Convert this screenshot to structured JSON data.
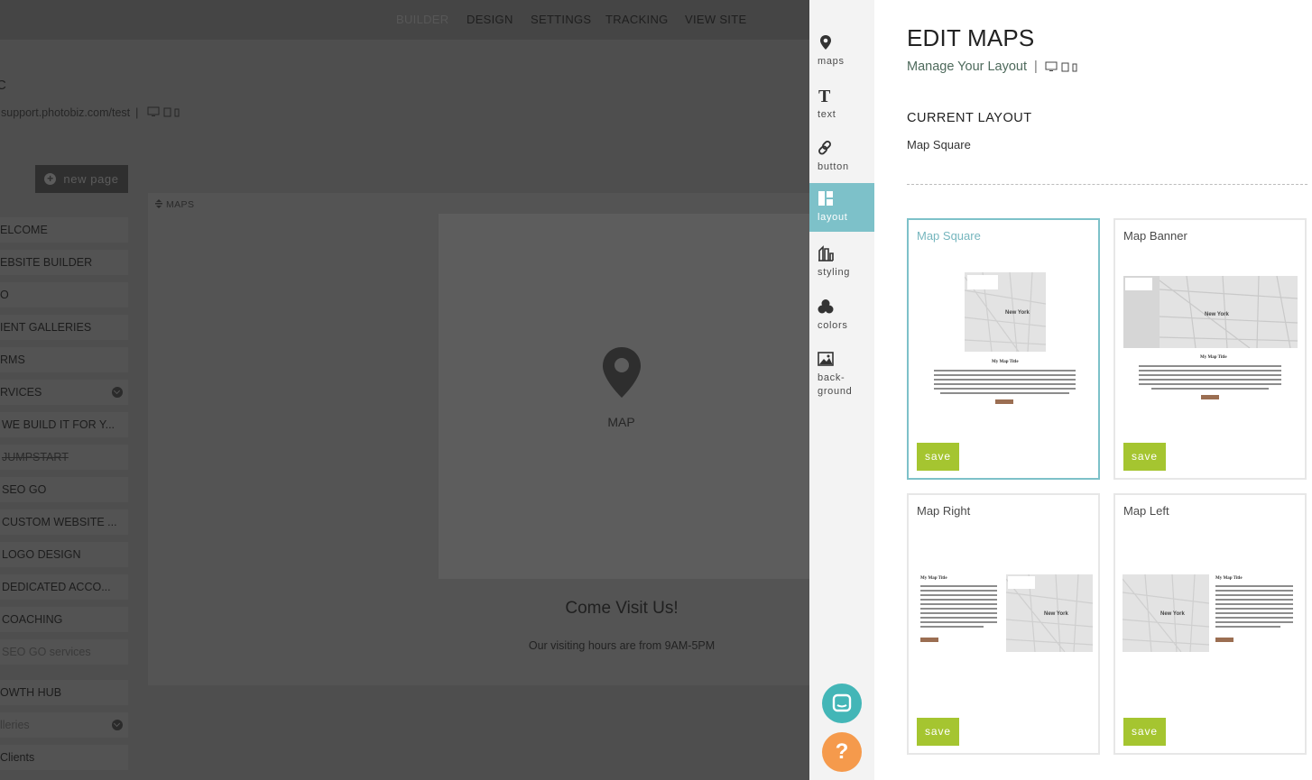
{
  "top_nav": {
    "items": [
      {
        "label": "BUILDER",
        "dim": true
      },
      {
        "label": "DESIGN",
        "dim": false
      },
      {
        "label": "SETTINGS",
        "dim": false
      },
      {
        "label": "TRACKING",
        "dim": false
      },
      {
        "label": "VIEW SITE",
        "dim": false
      }
    ]
  },
  "site": {
    "name": "C",
    "url": "support.photobiz.com/test",
    "separator": "|"
  },
  "new_page_label": "new page",
  "pages": [
    {
      "label": "ELCOME"
    },
    {
      "label": "EBSITE BUILDER"
    },
    {
      "label": "O"
    },
    {
      "label": "IENT GALLERIES"
    },
    {
      "label": "RMS"
    },
    {
      "label": "RVICES"
    },
    {
      "label": "WE BUILD IT FOR Y..."
    },
    {
      "label": "JUMPSTART"
    },
    {
      "label": "SEO GO"
    },
    {
      "label": "CUSTOM WEBSITE ..."
    },
    {
      "label": "LOGO DESIGN"
    },
    {
      "label": "DEDICATED ACCO..."
    },
    {
      "label": "COACHING"
    },
    {
      "label": "SEO GO services"
    },
    {
      "label": "OWTH HUB"
    },
    {
      "label": "lleries"
    },
    {
      "label": "Clients"
    }
  ],
  "canvas": {
    "section_label": "MAPS",
    "map_label": "MAP",
    "heading": "Come Visit Us!",
    "hours_text": "Our visiting hours are from 9AM-5PM"
  },
  "tools": [
    {
      "label": "maps",
      "icon": "map-pin-icon"
    },
    {
      "label": "text",
      "icon": "text-icon"
    },
    {
      "label": "button",
      "icon": "link-icon"
    },
    {
      "label": "layout",
      "icon": "layout-icon",
      "active": true
    },
    {
      "label": "styling",
      "icon": "styling-icon"
    },
    {
      "label": "colors",
      "icon": "colors-icon"
    },
    {
      "label": "back-",
      "label2": "ground",
      "icon": "image-icon"
    }
  ],
  "panel": {
    "title": "EDIT MAPS",
    "subtitle": "Manage Your Layout",
    "separator": "|",
    "current_layout_title": "CURRENT LAYOUT",
    "current_layout_name": "Map Square",
    "save_label": "save",
    "layouts": [
      {
        "name": "Map Square",
        "selected": true,
        "mini_title": "My Map Title"
      },
      {
        "name": "Map Banner",
        "selected": false,
        "mini_title": "My Map Title"
      },
      {
        "name": "Map Right",
        "selected": false,
        "mini_title": "My Map Title"
      },
      {
        "name": "Map Left",
        "selected": false,
        "mini_title": "My Map Title"
      }
    ],
    "accent_color": "#7dc1c9",
    "save_color": "#a5c530"
  },
  "floating": {
    "chat_icon": "chat-icon",
    "help_label": "?"
  }
}
